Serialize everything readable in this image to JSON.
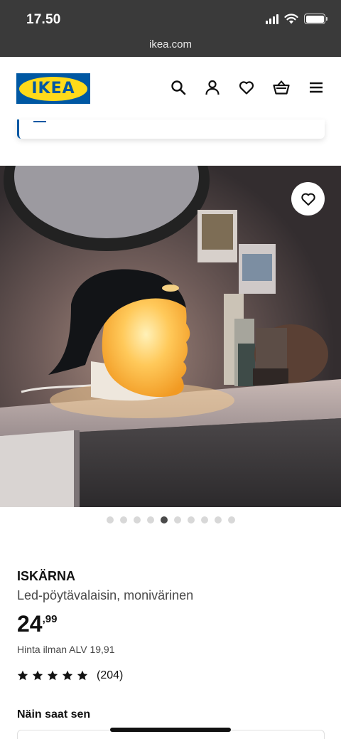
{
  "status_bar": {
    "time": "17.50",
    "url": "ikea.com"
  },
  "header": {
    "logo_text": "IKEA",
    "brand_colors": {
      "blue": "#0058a3",
      "yellow": "#ffda1a"
    },
    "icons": [
      "search-icon",
      "account-icon",
      "heart-icon",
      "basket-icon",
      "menu-icon"
    ]
  },
  "gallery": {
    "image_count": 10,
    "active_index": 4,
    "favorite_icon": "heart-icon"
  },
  "product": {
    "name": "ISKÄRNA",
    "description": "Led-pöytävalaisin, monivärinen",
    "price_int": "24",
    "price_dec": ",99",
    "vat_text": "Hinta ilman ALV 19,91",
    "rating_stars": 5,
    "rating_count": "(204)"
  },
  "delivery": {
    "title": "Näin saat sen"
  }
}
